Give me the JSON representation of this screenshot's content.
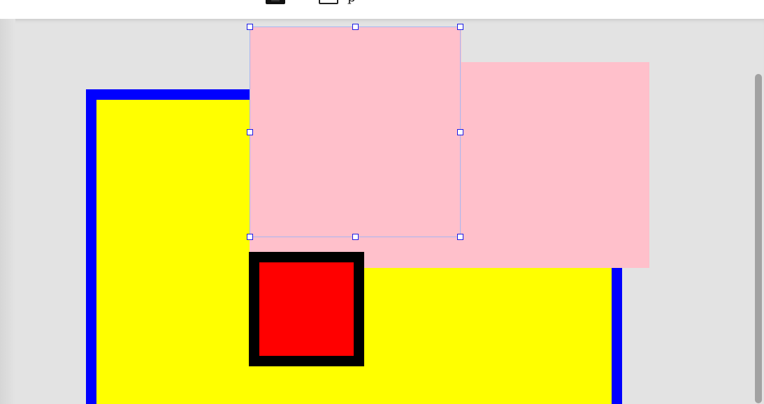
{
  "toolbar": {
    "mode_label": "p",
    "icons": [
      "filled-rectangle-icon",
      "outline-rectangle-icon"
    ]
  },
  "canvas": {
    "background_color": "#e3e3e3",
    "shapes": [
      {
        "name": "yellow-rectangle",
        "fill": "#ffff00",
        "stroke": "#0000ff"
      },
      {
        "name": "pink-rectangle-back",
        "fill": "#ffc0cb"
      },
      {
        "name": "pink-square-selected",
        "fill": "#ffc0cb",
        "selected": true
      },
      {
        "name": "red-square",
        "fill": "#ff0000",
        "stroke": "#000000"
      }
    ],
    "selection_handle_color": "#1a1ae6"
  }
}
